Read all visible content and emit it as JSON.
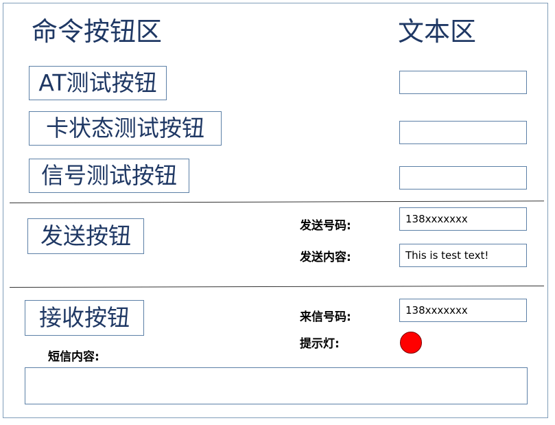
{
  "headings": {
    "commands": "命令按钮区",
    "text_area": "文本区"
  },
  "buttons": {
    "at_test": "AT测试按钮",
    "card_status_test": "卡状态测试按钮",
    "signal_test": "信号测试按钮",
    "send": "发送按钮",
    "receive": "接收按钮"
  },
  "test_fields": {
    "at_result": "",
    "card_status_result": "",
    "signal_result": ""
  },
  "send_section": {
    "number_label": "发送号码:",
    "number_value": "138xxxxxxx",
    "content_label": "发送内容:",
    "content_value": "This is test text!"
  },
  "receive_section": {
    "number_label": "来信号码:",
    "number_value": "138xxxxxxx",
    "indicator_label": "提示灯:",
    "indicator_color": "#ff0000",
    "sms_label": "短信内容:",
    "sms_value": ""
  }
}
